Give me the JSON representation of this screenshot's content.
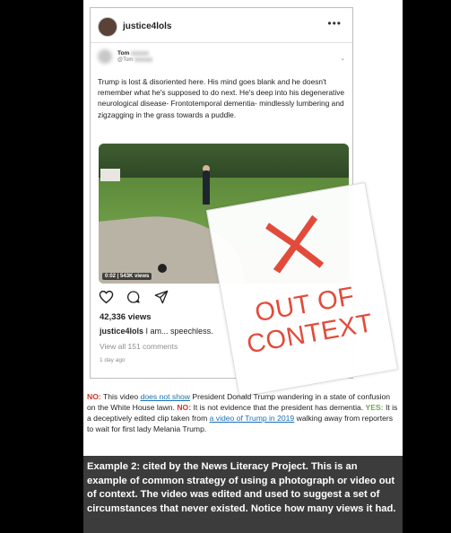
{
  "post": {
    "username": "justice4lols",
    "more_icon": "•••",
    "tweet": {
      "name": "Tom",
      "handle": "@Tom",
      "caret": "⌄",
      "text": "Trump is lost & disoriented here. His mind goes blank and he doesn't remember what he's supposed to do next. He's deep into his degenerative neurological disease- Frontotemporal dementia- mindlessly lumbering and zigzagging in the grass towards a puddle."
    },
    "video_badge": "0:02 | 543K views",
    "views": "42,336 views",
    "caption_user": "justice4lols",
    "caption_text": " I am... speechless.",
    "comments_link": "View all 151 comments",
    "age": "1 day ago"
  },
  "stamp": {
    "line1": "OUT OF",
    "line2": "CONTEXT",
    "color": "#e24b3b"
  },
  "factcheck": {
    "no1_label": "NO:",
    "no1_text_a": " This video ",
    "no1_link": "does not show",
    "no1_text_b": " President Donald Trump wandering in a state of confusion on the White House lawn. ",
    "no2_label": "NO:",
    "no2_text": " It is not evidence that the president has dementia. ",
    "yes_label": "YES:",
    "yes_text_a": " It is a deceptively edited clip taken from ",
    "yes_link": "a video of Trump in 2019",
    "yes_text_b": " walking away from reporters to wait for first lady Melania Trump."
  },
  "footer_text": "Example 2: cited by the News Literacy Project. This is an example of common strategy of using a photograph or video out of context. The video was edited and used to suggest a set of circumstances that never existed. Notice how many views it had."
}
